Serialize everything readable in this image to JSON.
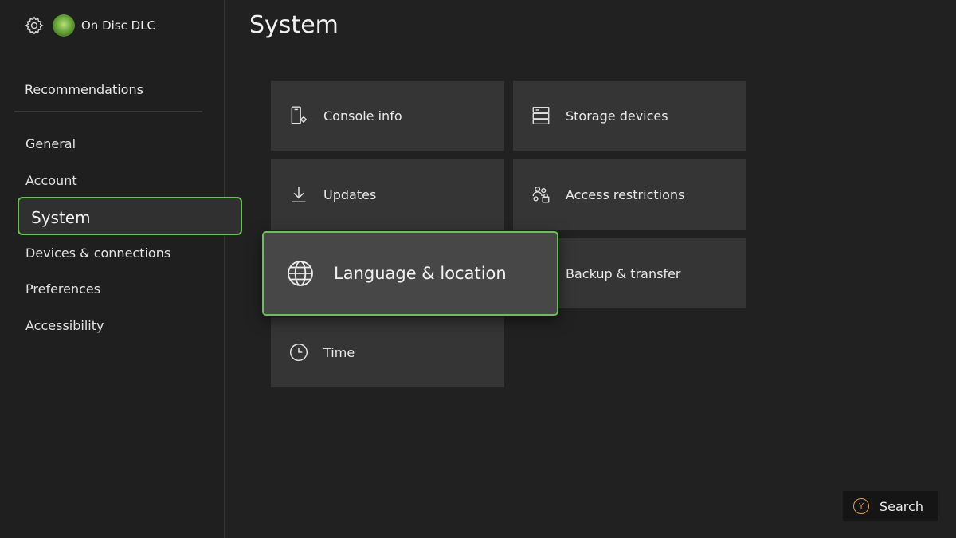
{
  "profile": {
    "name": "On Disc DLC"
  },
  "sidebar": {
    "recommendations": "Recommendations",
    "items": [
      {
        "label": "General"
      },
      {
        "label": "Account"
      },
      {
        "label": "System"
      },
      {
        "label": "Devices & connections"
      },
      {
        "label": "Preferences"
      },
      {
        "label": "Accessibility"
      }
    ],
    "selected": "System"
  },
  "main": {
    "title": "System",
    "tiles": [
      {
        "label": "Console info",
        "icon": "console-info-icon"
      },
      {
        "label": "Storage devices",
        "icon": "storage-icon"
      },
      {
        "label": "Updates",
        "icon": "download-icon"
      },
      {
        "label": "Access restrictions",
        "icon": "access-icon"
      },
      {
        "label": "Language & location",
        "icon": "globe-icon",
        "focused": true
      },
      {
        "label": "Backup & transfer",
        "icon": ""
      },
      {
        "label": "Time",
        "icon": "clock-icon"
      }
    ]
  },
  "footer": {
    "button_glyph": "Y",
    "search_label": "Search"
  },
  "colors": {
    "accent": "#6cbf57",
    "background": "#212121",
    "tile": "#353535",
    "y_button": "#e0a050"
  }
}
